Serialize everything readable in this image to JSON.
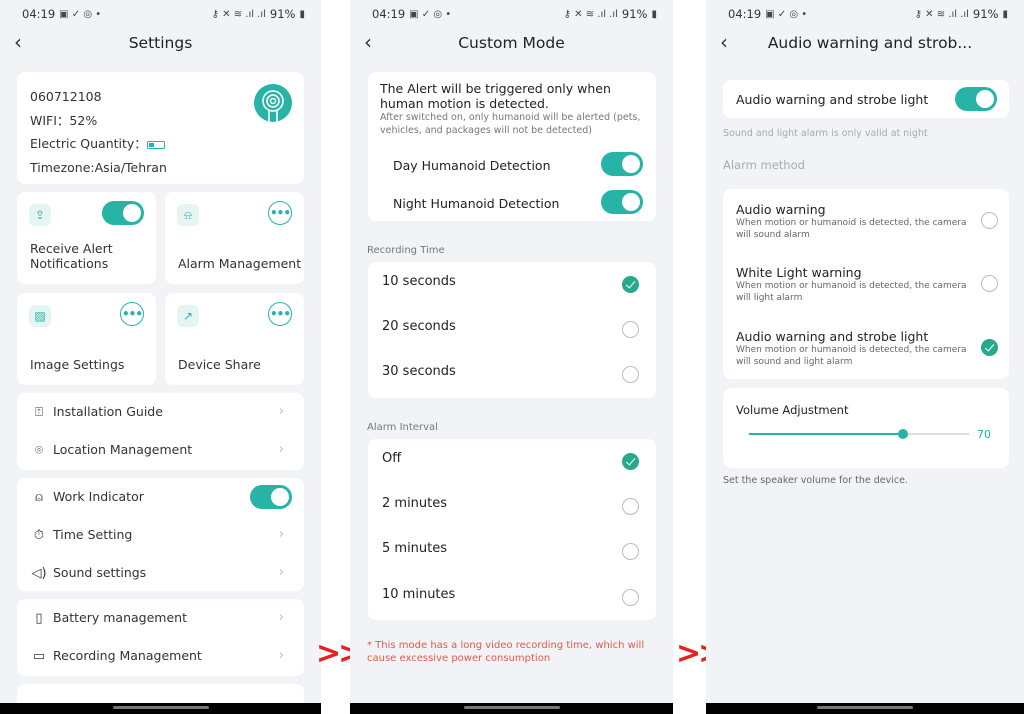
{
  "status_bar": {
    "time": "04:19",
    "battery": "91%"
  },
  "screens": {
    "settings": {
      "title": "Settings",
      "device": {
        "id": "060712108",
        "wifi": "WIFI：52%",
        "electric": "Electric Quantity：",
        "battery_level": 0.4,
        "timezone": "Timezone:Asia/Tehran"
      },
      "tiles": [
        {
          "label": "Receive Alert Notifications",
          "icon": "inbox-upload-icon",
          "control": "toggle",
          "on": true
        },
        {
          "label": "Alarm Management",
          "icon": "alarm-light-icon",
          "control": "more"
        },
        {
          "label": "Image Settings",
          "icon": "image-icon",
          "control": "more"
        },
        {
          "label": "Device Share",
          "icon": "share-icon",
          "control": "more"
        }
      ],
      "group1": [
        {
          "label": "Installation Guide",
          "icon": "installation-guide-icon"
        },
        {
          "label": "Location Management",
          "icon": "location-pin-icon"
        }
      ],
      "group2": [
        {
          "label": "Work Indicator",
          "icon": "indicator-lamp-icon",
          "toggle_on": true
        },
        {
          "label": "Time Setting",
          "icon": "timer-icon"
        },
        {
          "label": "Sound settings",
          "icon": "speaker-icon"
        }
      ],
      "group3": [
        {
          "label": "Battery management",
          "icon": "battery-icon"
        },
        {
          "label": "Recording Management",
          "icon": "video-camera-icon"
        }
      ]
    },
    "custom_mode": {
      "title": "Custom Mode",
      "info_title": "The Alert will be triggered only when human motion is detected.",
      "info_sub": "After switched on, only humanoid will be alerted (pets, vehicles, and packages will not be detected)",
      "day_detection": {
        "label": "Day Humanoid Detection",
        "on": true
      },
      "night_detection": {
        "label": "Night Humanoid Detection",
        "on": true
      },
      "recording_time": {
        "label": "Recording Time",
        "options": [
          "10 seconds",
          "20 seconds",
          "30 seconds"
        ],
        "selected": "10 seconds"
      },
      "alarm_interval": {
        "label": "Alarm Interval",
        "options": [
          "Off",
          "2 minutes",
          "5 minutes",
          "10 minutes"
        ],
        "selected": "Off"
      },
      "warning": "* This mode has a long video recording time, which will cause excessive power consumption"
    },
    "audio_warning": {
      "title": "Audio warning and strob...",
      "main_toggle": {
        "label": "Audio warning and strobe light",
        "on": true
      },
      "night_note": "Sound and light alarm is only valid at night",
      "alarm_method_label": "Alarm method",
      "methods": [
        {
          "title": "Audio warning",
          "desc": "When motion or humanoid is detected, the camera will sound alarm",
          "selected": false
        },
        {
          "title": "White Light warning",
          "desc": "When motion or humanoid is detected, the camera will light alarm",
          "selected": false
        },
        {
          "title": "Audio warning and strobe light",
          "desc": "When motion or humanoid is detected, the camera will sound and light alarm",
          "selected": true
        }
      ],
      "volume": {
        "label": "Volume Adjustment",
        "value": 70,
        "value_text": "70",
        "min": 0,
        "max": 100
      },
      "volume_note": "Set the speaker volume for the device."
    }
  },
  "transition_arrows": ">>",
  "colors": {
    "accent": "#27b3a6",
    "check": "#26a98d",
    "warning": "#e05a4e",
    "arrow": "#e82020"
  }
}
